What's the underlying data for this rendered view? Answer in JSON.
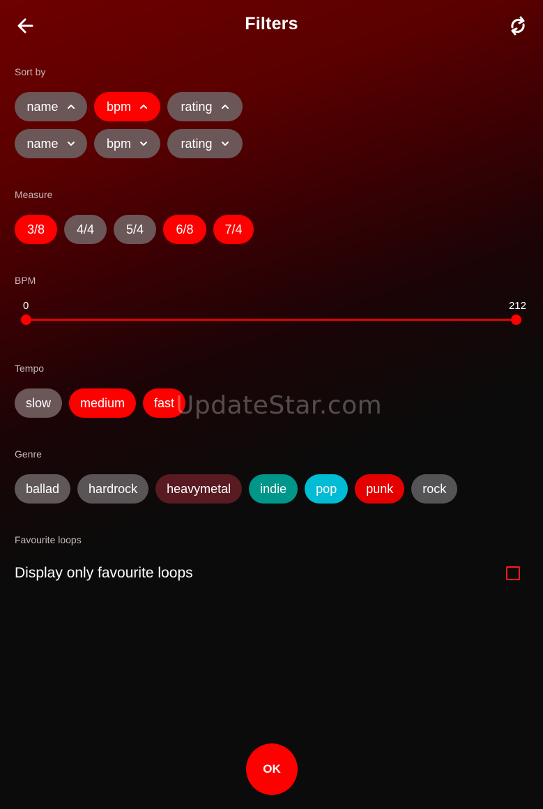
{
  "header": {
    "title": "Filters",
    "back_icon": "arrow-left-icon",
    "refresh_icon": "refresh-icon"
  },
  "sort": {
    "label": "Sort by",
    "ascending": [
      {
        "label": "name",
        "active": false
      },
      {
        "label": "bpm",
        "active": true
      },
      {
        "label": "rating",
        "active": false
      }
    ],
    "descending": [
      {
        "label": "name",
        "active": false
      },
      {
        "label": "bpm",
        "active": false
      },
      {
        "label": "rating",
        "active": false
      }
    ]
  },
  "measure": {
    "label": "Measure",
    "items": [
      {
        "label": "3/8",
        "active": true
      },
      {
        "label": "4/4",
        "active": false
      },
      {
        "label": "5/4",
        "active": false
      },
      {
        "label": "6/8",
        "active": true
      },
      {
        "label": "7/4",
        "active": true
      }
    ]
  },
  "bpm": {
    "label": "BPM",
    "min": "0",
    "max": "212"
  },
  "tempo": {
    "label": "Tempo",
    "items": [
      {
        "label": "slow",
        "active": false
      },
      {
        "label": "medium",
        "active": true
      },
      {
        "label": "fast",
        "active": true
      }
    ]
  },
  "genre": {
    "label": "Genre",
    "items": [
      {
        "label": "ballad",
        "color": "#5f5758"
      },
      {
        "label": "hardrock",
        "color": "#5a5456"
      },
      {
        "label": "heavymetal",
        "color": "#5a1a22"
      },
      {
        "label": "indie",
        "color": "#00968a"
      },
      {
        "label": "pop",
        "color": "#00bcd4"
      },
      {
        "label": "punk",
        "color": "#e50000"
      },
      {
        "label": "rock",
        "color": "#545456"
      }
    ]
  },
  "favourites": {
    "label": "Favourite loops",
    "option_text": "Display only favourite loops",
    "checked": false
  },
  "ok_button": "OK",
  "watermark": "UpdateStar.com",
  "colors": {
    "accent": "#ff0000",
    "chip_inactive": "#6b5658"
  }
}
